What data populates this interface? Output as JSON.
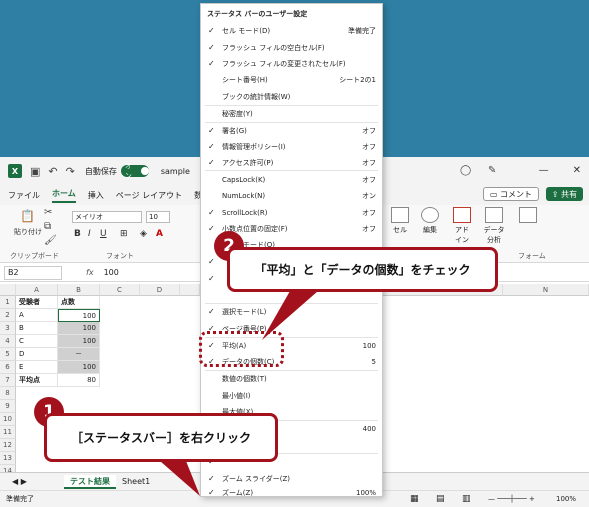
{
  "window": {
    "filename": "sample",
    "autosave_label": "自動保存",
    "autosave_state": "オン"
  },
  "tabs": [
    "ファイル",
    "ホーム",
    "挿入",
    "ページ レイアウト",
    "数式",
    "デ"
  ],
  "active_tab": "ホーム",
  "buttons": {
    "comment": "コメント",
    "share": "共有"
  },
  "ribbon": {
    "paste": "貼り付け",
    "clipboard": "クリップボード",
    "font_group": "フォント",
    "font_name": "メイリオ",
    "font_size": "10",
    "cell": "セル",
    "edit": "編集",
    "addin": "アド\nイン",
    "data_analysis": "データ\n分析",
    "form": "フォーム"
  },
  "formula_bar": {
    "name_box": "B2",
    "fx": "fx",
    "value": "100"
  },
  "columns": [
    "A",
    "B",
    "C",
    "D",
    "M",
    "N"
  ],
  "rows": [
    "1",
    "2",
    "3",
    "4",
    "5",
    "6",
    "7",
    "8",
    "9",
    "10",
    "11",
    "12",
    "13",
    "14",
    "15"
  ],
  "cells": [
    {
      "a": "受験者",
      "b": "点数"
    },
    {
      "a": "A",
      "b": "100"
    },
    {
      "a": "B",
      "b": "100"
    },
    {
      "a": "C",
      "b": "100"
    },
    {
      "a": "D",
      "b": "－"
    },
    {
      "a": "E",
      "b": "100"
    },
    {
      "a": "平均点",
      "b": "80"
    }
  ],
  "sheets": [
    "テスト結果",
    "Sheet1"
  ],
  "status": {
    "ready": "準備完了",
    "zoom": "100%"
  },
  "menu": {
    "title": "ステータス バーのユーザー設定",
    "items": [
      {
        "check": "✓",
        "label": "セル モード(D)",
        "value": "準備完了"
      },
      {
        "check": "✓",
        "label": "フラッシュ フィルの空白セル(F)",
        "value": ""
      },
      {
        "check": "✓",
        "label": "フラッシュ フィルの変更されたセル(F)",
        "value": ""
      },
      {
        "check": "",
        "label": "シート番号(H)",
        "value": "シート2の1"
      },
      {
        "check": "",
        "label": "ブックの統計情報(W)",
        "value": ""
      },
      {
        "check": "",
        "label": "秘密度(Y)",
        "value": ""
      },
      {
        "check": "✓",
        "label": "署名(G)",
        "value": "オフ"
      },
      {
        "check": "✓",
        "label": "情報管理ポリシー(I)",
        "value": "オフ"
      },
      {
        "check": "✓",
        "label": "アクセス許可(P)",
        "value": "オフ"
      },
      {
        "check": "",
        "label": "CapsLock(K)",
        "value": "オフ"
      },
      {
        "check": "",
        "label": "NumLock(N)",
        "value": "オン"
      },
      {
        "check": "✓",
        "label": "ScrollLock(R)",
        "value": "オフ"
      },
      {
        "check": "✓",
        "label": "小数点位置の固定(F)",
        "value": "オフ"
      },
      {
        "check": "",
        "label": "上書きモード(O)",
        "value": ""
      },
      {
        "check": "✓",
        "label": "",
        "value": ""
      },
      {
        "check": "✓",
        "label": "",
        "value": ""
      },
      {
        "check": "✓",
        "label": "選択モード(L)",
        "value": ""
      },
      {
        "check": "✓",
        "label": "ページ番号(P)",
        "value": ""
      },
      {
        "check": "✓",
        "label": "平均(A)",
        "value": "100"
      },
      {
        "check": "✓",
        "label": "データの個数(C)",
        "value": "5"
      },
      {
        "check": "",
        "label": "数値の個数(T)",
        "value": ""
      },
      {
        "check": "",
        "label": "最小値(I)",
        "value": ""
      },
      {
        "check": "",
        "label": "最大値(X)",
        "value": ""
      },
      {
        "check": "✓",
        "label": "",
        "value": "400"
      },
      {
        "check": "",
        "label": "",
        "value": ""
      },
      {
        "check": "✓",
        "label": "",
        "value": ""
      },
      {
        "check": "✓",
        "label": "ズーム スライダー(Z)",
        "value": ""
      },
      {
        "check": "✓",
        "label": "ズーム(Z)",
        "value": "100%"
      }
    ]
  },
  "annotations": {
    "step1_number": "1",
    "step1_text": "［ステータスバー］を右クリック",
    "step2_number": "2",
    "step2_text": "「平均」と「データの個数」をチェック"
  },
  "colors": {
    "accent": "#a3111c",
    "excel_green": "#1d6f42",
    "background": "#2e7fa3"
  }
}
